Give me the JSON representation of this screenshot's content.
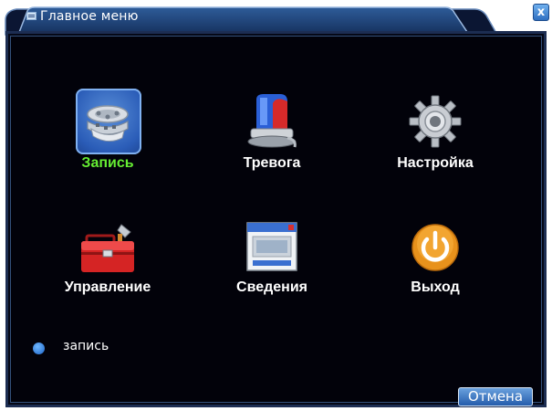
{
  "window": {
    "title": "Главное меню",
    "close_label": "x"
  },
  "menu": {
    "items": [
      {
        "id": "record",
        "label": "Запись",
        "icon": "film-reel-icon",
        "selected": true
      },
      {
        "id": "alarm",
        "label": "Тревога",
        "icon": "siren-icon",
        "selected": false
      },
      {
        "id": "settings",
        "label": "Настройка",
        "icon": "gear-icon",
        "selected": false
      },
      {
        "id": "management",
        "label": "Управление",
        "icon": "toolbox-icon",
        "selected": false
      },
      {
        "id": "info",
        "label": "Сведения",
        "icon": "info-window-icon",
        "selected": false
      },
      {
        "id": "exit",
        "label": "Выход",
        "icon": "power-icon",
        "selected": false
      }
    ]
  },
  "status": {
    "text": "запись"
  },
  "footer": {
    "cancel_label": "Отмена"
  },
  "colors": {
    "background": "#02020a",
    "frame": "#1c2d52",
    "selected_label": "#66ee33",
    "label": "#ffffff",
    "button": "#2f6fc0"
  }
}
